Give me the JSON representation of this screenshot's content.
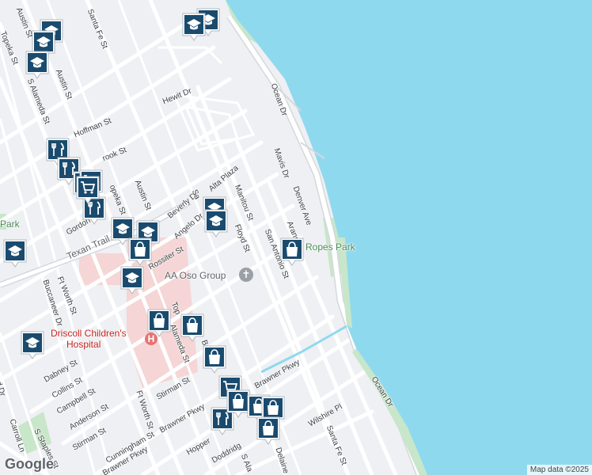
{
  "map": {
    "colors": {
      "water": "#8fd9ee",
      "land": "#eef0f3",
      "road": "#ffffff",
      "park": "#c8e6c9",
      "hospital": "#f5d5d5",
      "pin": "#1a4b6e"
    },
    "labels": {
      "austin_st_nw": "Austin St",
      "topeka_st_nw": "Topeka St",
      "santa_fe_st_n": "Santa Fe St",
      "austin_st": "Austin St",
      "s_alameda_st_n": "S Alameda St",
      "hewit_dr": "Hewit Dr",
      "hoffman_st": "Hoffman St",
      "ocean_dr_n": "Ocean Dr",
      "mavis_dr": "Mavis Dr",
      "denver_ave": "Denver Ave",
      "brook_st": "rook St",
      "topeka_st_mid": "opeka St",
      "austin_st_mid": "Austin St",
      "alta_plaza": "Alta Plaza",
      "beverly_dr": "Beverly Dr",
      "sa_dr": "Sa",
      "manitou_st": "Manitou St",
      "aransas": "Aransa",
      "gordon": "Gordon",
      "angelo_dr": "Angelo Dr",
      "floyd_st": "Floyd St",
      "san_antonio_st": "San Antonio St",
      "ropes_park": "Ropes Park",
      "texan_trail": "Texan Trail",
      "rossiter_st": "Rossiter St",
      "aa_oso": "AA Oso Group",
      "park_w": "Park",
      "ft_worth_st_n": "Ft Worth St",
      "buccaneer": "Buccaneer Dr",
      "driscoll1": "Driscoll Children's",
      "driscoll2": "Hospital",
      "alameda_st_mid": "Alameda St",
      "topeka_mid2": "Top",
      "bo_st": "Bo",
      "dabney_st": "Dabney St",
      "collins_st": "Collins St",
      "campbell_st": "Campbell St",
      "anderson_st": "Anderson St",
      "ft_worth_st_s": "Ft Worth St",
      "stirman_st_e": "Stirman St",
      "brawner_pkwy_e": "Brawner Pkwy",
      "carroll_ln": "Carroll Ln",
      "s_staples_st": "S Staples St",
      "stirman_st_w": "Stirman St",
      "cunningham_st": "Cunningham St",
      "brawner_pkwy_m": "Brawner Pkwy",
      "brawner_pkwy_w": "Brawner Pkwy",
      "hopper": "Hopper",
      "doddridge": "Doddridg",
      "s_ala": "S Ala",
      "delaine_dr": "Delaine Dr",
      "wilshire_pl": "Wilshire Pl",
      "santa_fe_st_s": "Santa Fe St",
      "ocean_dr_s": "Ocean Dr",
      "ard_dr": "ard Dr"
    },
    "markers": [
      {
        "kind": "school-icon"
      },
      {
        "kind": "school-icon"
      },
      {
        "kind": "school-icon"
      },
      {
        "kind": "school-icon"
      },
      {
        "kind": "school-icon"
      },
      {
        "kind": "school-icon"
      },
      {
        "kind": "school-icon"
      },
      {
        "kind": "school-icon"
      },
      {
        "kind": "school-icon"
      },
      {
        "kind": "school-icon"
      },
      {
        "kind": "school-icon"
      },
      {
        "kind": "school-icon"
      },
      {
        "kind": "restaurant-icon"
      },
      {
        "kind": "restaurant-icon"
      },
      {
        "kind": "restaurant-icon"
      },
      {
        "kind": "restaurant-icon"
      },
      {
        "kind": "restaurant-icon"
      },
      {
        "kind": "grocery-cart-icon"
      },
      {
        "kind": "grocery-cart-icon"
      },
      {
        "kind": "grocery-cart-icon"
      },
      {
        "kind": "shopping-bag-icon"
      },
      {
        "kind": "shopping-bag-icon"
      },
      {
        "kind": "shopping-bag-icon"
      },
      {
        "kind": "shopping-bag-icon"
      },
      {
        "kind": "shopping-bag-icon"
      },
      {
        "kind": "shopping-bag-icon"
      },
      {
        "kind": "shopping-bag-icon"
      },
      {
        "kind": "shopping-bag-icon"
      },
      {
        "kind": "shopping-bag-icon"
      }
    ],
    "attribution": {
      "logo": "Google",
      "copyright": "Map data ©2025"
    }
  }
}
